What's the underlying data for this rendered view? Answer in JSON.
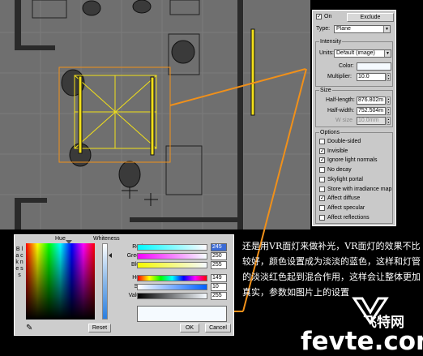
{
  "panel": {
    "on_label": "On",
    "on_checked": true,
    "exclude_label": "Exclude",
    "type_label": "Type:",
    "type_value": "Plane",
    "intensity": {
      "title": "Intensity",
      "units_label": "Units:",
      "units_value": "Default (image)",
      "color_label": "Color:",
      "multiplier_label": "Multiplier:",
      "multiplier_value": "10.0"
    },
    "size": {
      "title": "Size",
      "half_length_label": "Half-length:",
      "half_length_value": "876.802m",
      "half_width_label": "Half-width:",
      "half_width_value": "752.504m",
      "w_size_label": "W size",
      "w_size_value": "10.0mm"
    },
    "options": {
      "title": "Options",
      "items": [
        {
          "label": "Double-sided",
          "checked": false
        },
        {
          "label": "Invisible",
          "checked": true
        },
        {
          "label": "Ignore light normals",
          "checked": true
        },
        {
          "label": "No decay",
          "checked": false
        },
        {
          "label": "Skylight portal",
          "checked": false
        },
        {
          "label": "Store with irradiance map",
          "checked": false
        },
        {
          "label": "Affect diffuse",
          "checked": true
        },
        {
          "label": "Affect specular",
          "checked": false
        },
        {
          "label": "Affect reflections",
          "checked": false
        }
      ]
    }
  },
  "picker": {
    "hue_label": "Hue",
    "whiteness_label": "Whiteness",
    "blackness_label": "B l a c k n e s s",
    "red_label": "Red:",
    "red_value": "245",
    "green_label": "Green:",
    "green_value": "250",
    "blue_label": "Blue:",
    "blue_value": "255",
    "hue2_label": "Hue:",
    "hue2_value": "149",
    "sat_label": "Sat:",
    "sat_value": "10",
    "value_label": "Value:",
    "value_value": "255",
    "reset_label": "Reset",
    "ok_label": "OK",
    "cancel_label": "Cancel",
    "swatch_color": "#f5faff"
  },
  "caption": "还是用VR面灯来做补光，VR面灯的效果不比较好，颜色设置成为淡淡的蓝色，这样和灯管的淡淡红色起到混合作用，这样会让整体更加真实，参数如图片上的设置",
  "watermark": {
    "site": "fevte.com",
    "name": "飞特网"
  },
  "colors": {
    "accent_orange": "#f0901a",
    "light_yellow": "#f2e01a"
  }
}
